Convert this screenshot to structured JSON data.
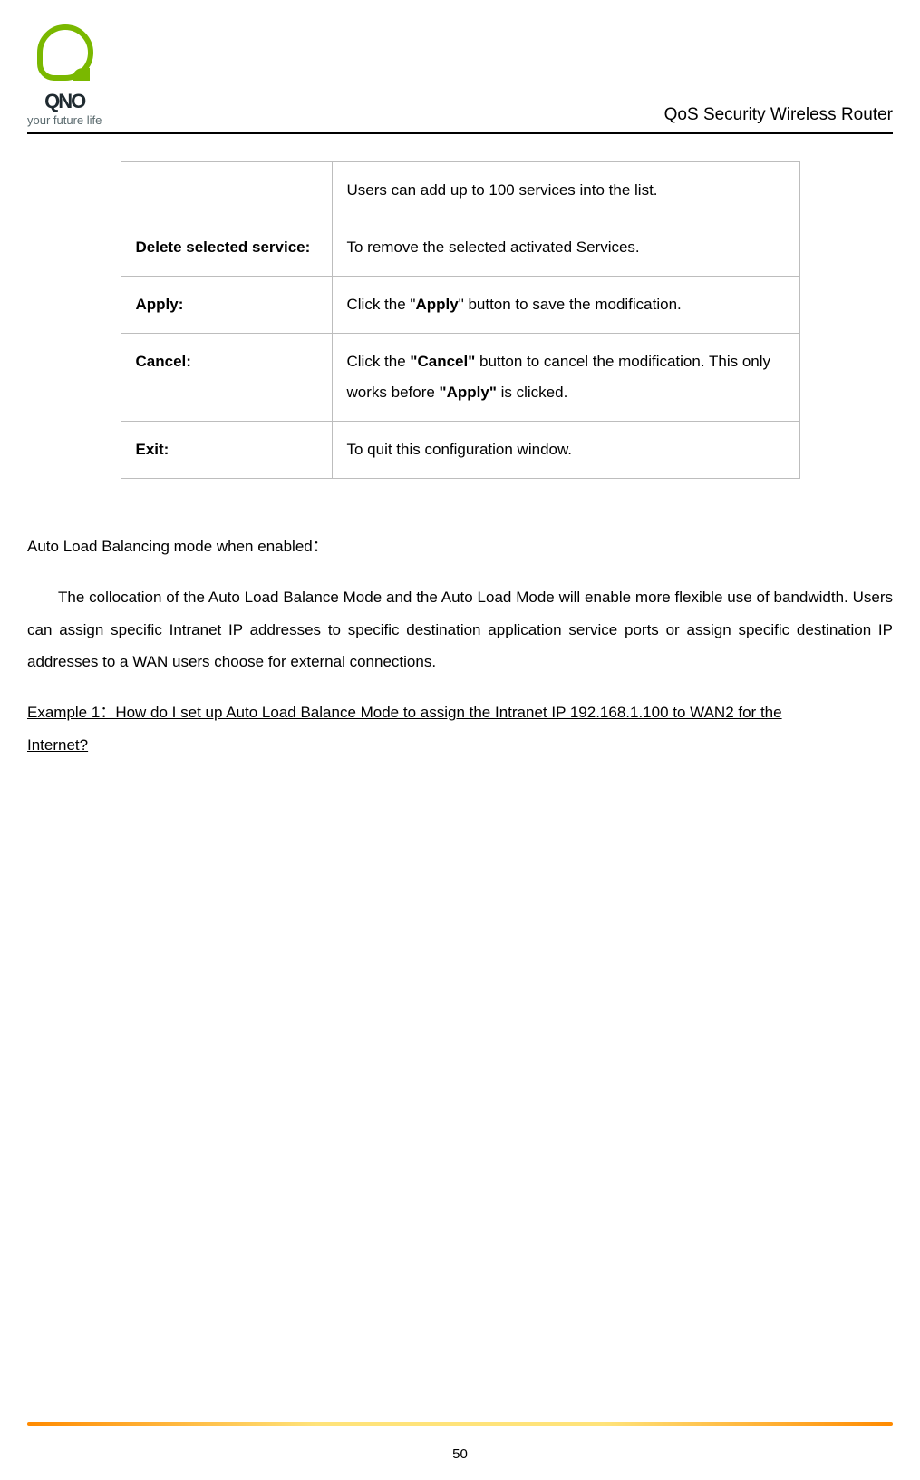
{
  "header": {
    "brand": "QNO",
    "tagline": "your future life",
    "doc_title": "QoS Security Wireless Router"
  },
  "table": {
    "rows": [
      {
        "label": "",
        "desc_plain": "Users can add up to 100 services into the list."
      },
      {
        "label": "Delete selected service:",
        "desc_plain": "To remove the selected activated Services."
      },
      {
        "label": "Apply:",
        "desc_pre": "Click the \"",
        "desc_b1": "Apply",
        "desc_post": "\" button to save the modification."
      },
      {
        "label": "Cancel:",
        "desc_pre2": "Click the ",
        "desc_b2a": "\"Cancel\"",
        "desc_mid2": " button to cancel the modification. This only works before ",
        "desc_b2b": "\"Apply\"",
        "desc_post2": " is clicked."
      },
      {
        "label": "Exit:",
        "desc_plain": "To quit this configuration window."
      }
    ]
  },
  "section_heading": "Auto Load Balancing mode when enabled：",
  "paragraph": "The collocation of the Auto Load Balance Mode and the Auto Load Mode will enable more flexible use of bandwidth. Users can assign specific Intranet IP addresses to specific destination application service ports or assign specific destination IP addresses to a WAN users choose for external connections.",
  "example_line1": "Example 1：How do I set up Auto Load Balance Mode to assign the Intranet IP 192.168.1.100 to WAN2 for the",
  "example_line2": "Internet?",
  "page_number": "50"
}
